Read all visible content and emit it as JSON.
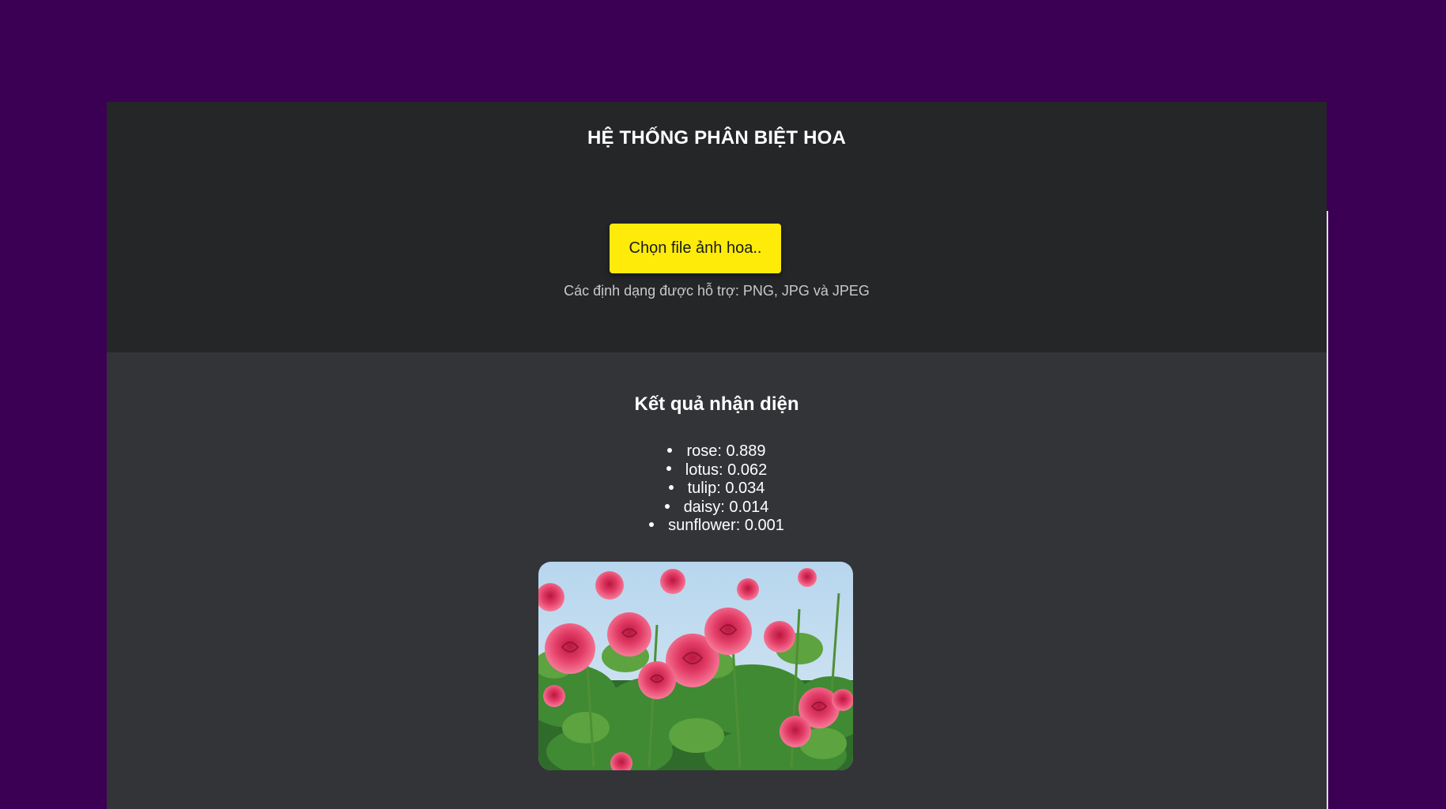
{
  "header": {
    "title": "HỆ THỐNG PHÂN BIỆT HOA",
    "choose_file_label": "Chọn file ảnh hoa..",
    "supported_formats": "Các định dạng được hỗ trợ: PNG, JPG và JPEG"
  },
  "results": {
    "title": "Kết quả nhận diện",
    "predictions": [
      {
        "text": "rose: 0.889"
      },
      {
        "text": "lotus: 0.062"
      },
      {
        "text": "tulip: 0.034"
      },
      {
        "text": "daisy: 0.014"
      },
      {
        "text": "sunflower: 0.001"
      }
    ]
  },
  "colors": {
    "page_background": "#3b0053",
    "upload_panel": "#252628",
    "result_panel": "#333438",
    "button": "#ffeb0a"
  }
}
